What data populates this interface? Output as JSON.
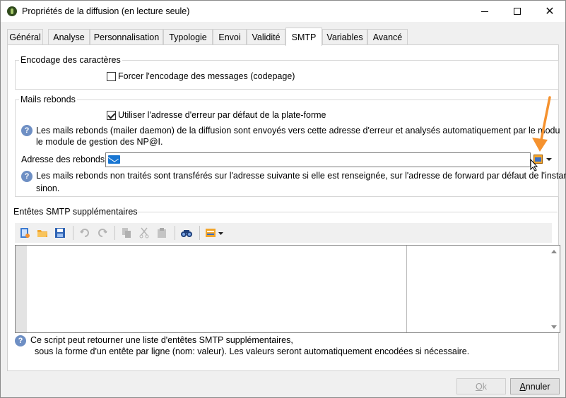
{
  "window": {
    "title": "Propriétés de la diffusion (en lecture seule)",
    "minimize_glyph": "—",
    "maximize_glyph": "☐",
    "close_glyph": "✕"
  },
  "tabs": [
    {
      "label": "Général",
      "active": false
    },
    {
      "label": "Analyse",
      "active": false
    },
    {
      "label": "Personnalisation",
      "active": false
    },
    {
      "label": "Typologie",
      "active": false
    },
    {
      "label": "Envoi",
      "active": false
    },
    {
      "label": "Validité",
      "active": false
    },
    {
      "label": "SMTP",
      "active": true
    },
    {
      "label": "Variables",
      "active": false
    },
    {
      "label": "Avancé",
      "active": false
    }
  ],
  "encoding": {
    "group_label": "Encodage des caractères",
    "force_label": "Forcer l'encodage des messages (codepage)",
    "force_checked": false
  },
  "bounce": {
    "group_label": "Mails rebonds",
    "use_default_label": "Utiliser l'adresse d'erreur par défaut de la plate-forme",
    "use_default_checked": true,
    "help1_line1": "Les mails rebonds (mailer daemon) de la diffusion sont envoyés vers cette adresse d'erreur et analysés automatiquement par le modu",
    "help1_line2": "le module de gestion des NP@I.",
    "address_label": "Adresse des rebonds :",
    "address_value": "",
    "help2_line1": "Les mails rebonds non traités sont transférés sur l'adresse suivante si elle est renseignée, sur l'adresse de forward par défaut de l'instance",
    "help2_line2": "sinon."
  },
  "smtp_headers": {
    "group_label": "Entêtes SMTP supplémentaires",
    "toolbar_icons": [
      "new-icon",
      "open-folder-icon",
      "save-icon",
      "undo-icon",
      "redo-icon",
      "copy-icon",
      "cut-icon",
      "paste-icon",
      "find-icon",
      "insert-field-icon"
    ],
    "help_line1": "Ce script peut retourner une liste d'entêtes SMTP supplémentaires,",
    "help_line2": "sous la forme d'un entête par ligne (nom: valeur). Les valeurs seront automatiquement encodées si nécessaire."
  },
  "buttons": {
    "ok": "Ok",
    "cancel": "Annuler"
  },
  "colors": {
    "accent_orange": "#f5922f",
    "help_icon": "#6e8fc4"
  }
}
